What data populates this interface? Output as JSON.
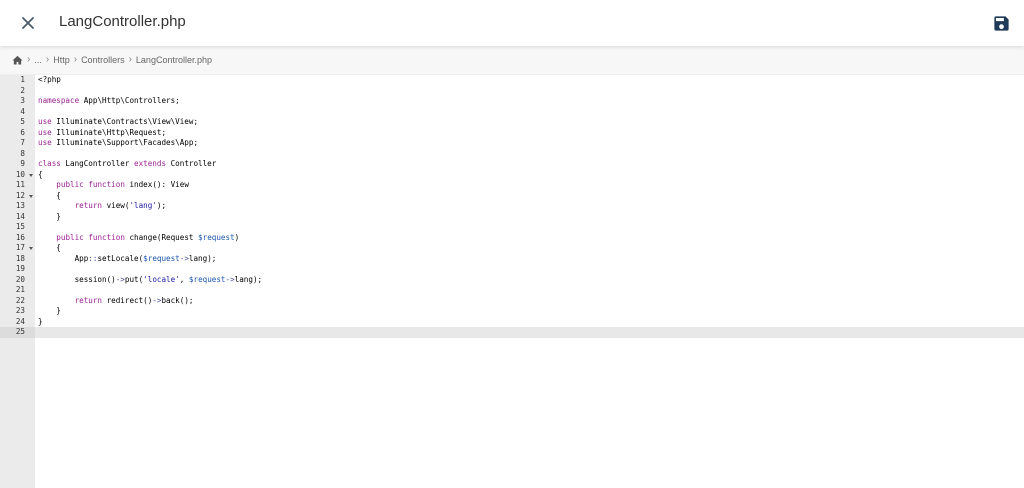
{
  "header": {
    "title": "LangController.php",
    "close_icon": "close-icon",
    "save_icon": "floppy-disk-icon"
  },
  "breadcrumb": [
    {
      "label": "...",
      "kind": "item"
    },
    {
      "label": "Http",
      "kind": "item"
    },
    {
      "label": "Controllers",
      "kind": "item"
    },
    {
      "label": "LangController.php",
      "kind": "item"
    }
  ],
  "editor": {
    "active_line": 25,
    "lines": [
      {
        "n": "1",
        "fold": false,
        "tokens": [
          {
            "t": "<?php",
            "c": "plain"
          }
        ]
      },
      {
        "n": "2",
        "fold": false,
        "tokens": []
      },
      {
        "n": "3",
        "fold": false,
        "tokens": [
          {
            "t": "namespace",
            "c": "kw"
          },
          {
            "t": " App\\Http\\Controllers;",
            "c": "plain"
          }
        ]
      },
      {
        "n": "4",
        "fold": false,
        "tokens": []
      },
      {
        "n": "5",
        "fold": false,
        "tokens": [
          {
            "t": "use",
            "c": "kw"
          },
          {
            "t": " Illuminate\\Contracts\\View\\View;",
            "c": "plain"
          }
        ]
      },
      {
        "n": "6",
        "fold": false,
        "tokens": [
          {
            "t": "use",
            "c": "kw"
          },
          {
            "t": " Illuminate\\Http\\Request;",
            "c": "plain"
          }
        ]
      },
      {
        "n": "7",
        "fold": false,
        "tokens": [
          {
            "t": "use",
            "c": "kw"
          },
          {
            "t": " Illuminate\\Support\\Facades\\App;",
            "c": "plain"
          }
        ]
      },
      {
        "n": "8",
        "fold": false,
        "tokens": []
      },
      {
        "n": "9",
        "fold": false,
        "tokens": [
          {
            "t": "class",
            "c": "kw"
          },
          {
            "t": " LangController ",
            "c": "plain"
          },
          {
            "t": "extends",
            "c": "kw"
          },
          {
            "t": " Controller",
            "c": "plain"
          }
        ]
      },
      {
        "n": "10",
        "fold": true,
        "tokens": [
          {
            "t": "{",
            "c": "plain"
          }
        ]
      },
      {
        "n": "11",
        "fold": false,
        "tokens": [
          {
            "t": "    ",
            "c": "plain"
          },
          {
            "t": "public",
            "c": "kw"
          },
          {
            "t": " ",
            "c": "plain"
          },
          {
            "t": "function",
            "c": "kw"
          },
          {
            "t": " index(): View",
            "c": "plain"
          }
        ]
      },
      {
        "n": "12",
        "fold": true,
        "tokens": [
          {
            "t": "    {",
            "c": "plain"
          }
        ]
      },
      {
        "n": "13",
        "fold": false,
        "tokens": [
          {
            "t": "        ",
            "c": "plain"
          },
          {
            "t": "return",
            "c": "kw"
          },
          {
            "t": " view(",
            "c": "plain"
          },
          {
            "t": "'lang'",
            "c": "str"
          },
          {
            "t": ");",
            "c": "plain"
          }
        ]
      },
      {
        "n": "14",
        "fold": false,
        "tokens": [
          {
            "t": "    }",
            "c": "plain"
          }
        ]
      },
      {
        "n": "15",
        "fold": false,
        "tokens": []
      },
      {
        "n": "16",
        "fold": false,
        "tokens": [
          {
            "t": "    ",
            "c": "plain"
          },
          {
            "t": "public",
            "c": "kw"
          },
          {
            "t": " ",
            "c": "plain"
          },
          {
            "t": "function",
            "c": "kw"
          },
          {
            "t": " change(Request ",
            "c": "plain"
          },
          {
            "t": "$request",
            "c": "var"
          },
          {
            "t": ")",
            "c": "plain"
          }
        ]
      },
      {
        "n": "17",
        "fold": true,
        "tokens": [
          {
            "t": "    {",
            "c": "plain"
          }
        ]
      },
      {
        "n": "18",
        "fold": false,
        "tokens": [
          {
            "t": "        App",
            "c": "plain"
          },
          {
            "t": "::",
            "c": "op"
          },
          {
            "t": "setLocale(",
            "c": "plain"
          },
          {
            "t": "$request",
            "c": "var"
          },
          {
            "t": "->",
            "c": "op"
          },
          {
            "t": "lang);",
            "c": "plain"
          }
        ]
      },
      {
        "n": "19",
        "fold": false,
        "tokens": []
      },
      {
        "n": "20",
        "fold": false,
        "tokens": [
          {
            "t": "        session()",
            "c": "plain"
          },
          {
            "t": "->",
            "c": "op"
          },
          {
            "t": "put(",
            "c": "plain"
          },
          {
            "t": "'locale'",
            "c": "str"
          },
          {
            "t": ", ",
            "c": "plain"
          },
          {
            "t": "$request",
            "c": "var"
          },
          {
            "t": "->",
            "c": "op"
          },
          {
            "t": "lang);",
            "c": "plain"
          }
        ]
      },
      {
        "n": "21",
        "fold": false,
        "tokens": []
      },
      {
        "n": "22",
        "fold": false,
        "tokens": [
          {
            "t": "        ",
            "c": "plain"
          },
          {
            "t": "return",
            "c": "kw"
          },
          {
            "t": " redirect()",
            "c": "plain"
          },
          {
            "t": "->",
            "c": "op"
          },
          {
            "t": "back();",
            "c": "plain"
          }
        ]
      },
      {
        "n": "23",
        "fold": false,
        "tokens": [
          {
            "t": "    }",
            "c": "plain"
          }
        ]
      },
      {
        "n": "24",
        "fold": false,
        "tokens": [
          {
            "t": "}",
            "c": "plain"
          }
        ]
      },
      {
        "n": "25",
        "fold": false,
        "tokens": []
      }
    ]
  }
}
